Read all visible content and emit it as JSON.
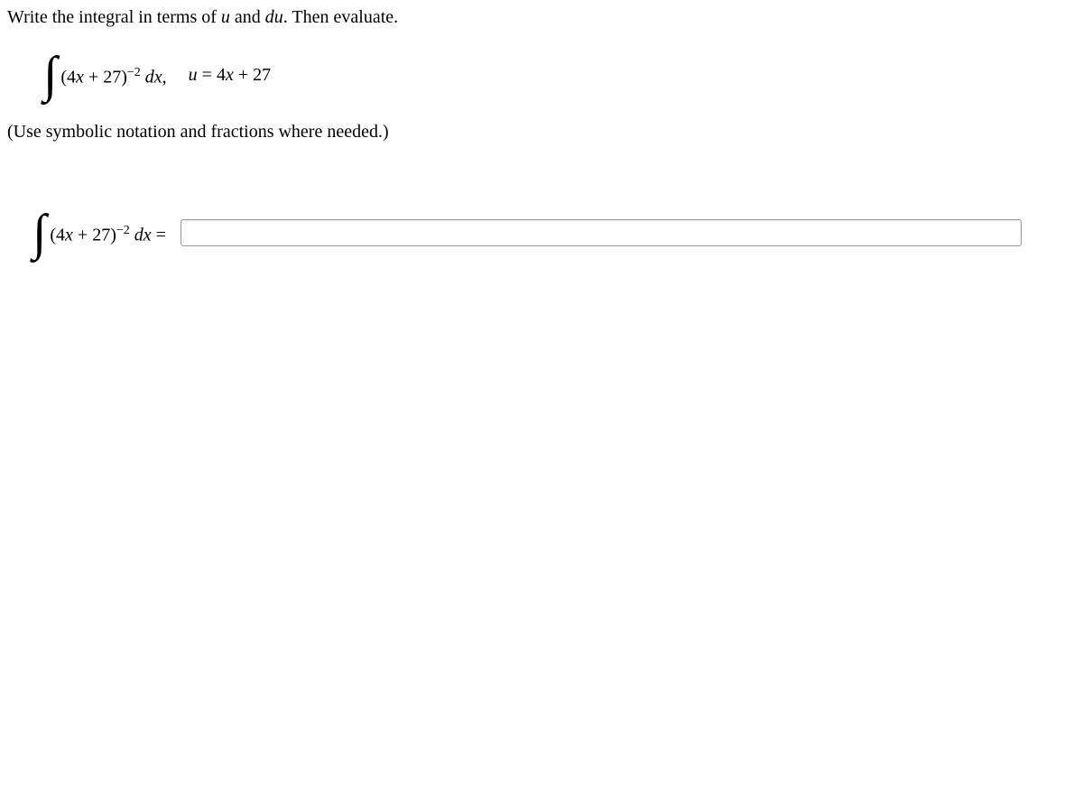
{
  "question": {
    "prefix": "Write the integral in terms of ",
    "u": "u",
    "mid": " and ",
    "du": "du",
    "suffix": ". Then evaluate."
  },
  "integral": {
    "sign": "∫",
    "lparen": "(",
    "coeff": "4",
    "x": "x",
    "plus": " + ",
    "const": "27",
    "rparen": ")",
    "exp": "−2",
    "space": " ",
    "d": "d",
    "xvar": "x",
    "comma": ","
  },
  "condition": {
    "u": "u",
    "eq": " = ",
    "coeff": "4",
    "x": "x",
    "plus": " + ",
    "const": "27"
  },
  "hint": "(Use symbolic notation and fractions where needed.)",
  "answer_integral": {
    "sign": "∫",
    "lparen": "(",
    "coeff": "4",
    "x": "x",
    "plus": " + ",
    "const": "27",
    "rparen": ")",
    "exp": "−2",
    "space": " ",
    "d": "d",
    "xvar": "x",
    "eq": " ="
  },
  "answer_value": ""
}
